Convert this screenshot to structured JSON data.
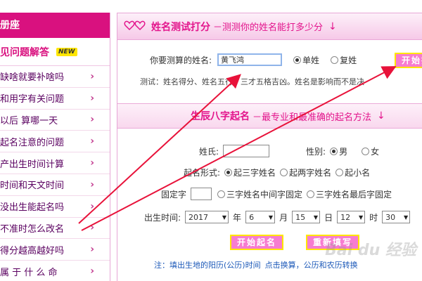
{
  "sidebar": {
    "header": "册座",
    "section_title": "见问题解答",
    "badge": "NEW",
    "items": [
      {
        "label": "缺啥就要补啥吗"
      },
      {
        "label": "和用字有关问题"
      },
      {
        "label": "以后  算哪一天"
      },
      {
        "label": "起名注意的问题"
      },
      {
        "label": "产出生时间计算"
      },
      {
        "label": "时间和天文时间"
      },
      {
        "label": "没出生能起名吗"
      },
      {
        "label": "不准时怎么改名"
      },
      {
        "label": "得分越高越好吗"
      },
      {
        "label": "属 于 什 么 命"
      }
    ],
    "chevron": "›"
  },
  "score_section": {
    "title": "姓名测试打分",
    "subtitle": "－测测你的姓名能打多少分",
    "arrow": "↓",
    "name_label": "你要测算的姓名:",
    "name_value": "黄飞鸿",
    "radio_single": "单姓",
    "radio_double": "复姓",
    "submit": "开始打",
    "desc": "测试：姓名得分、姓名五行、三才五格吉凶。姓名是影响而不是决"
  },
  "bazi_section": {
    "title": "生辰八字起名",
    "subtitle": "－最专业和最准确的起名方法",
    "arrow": "↓",
    "surname_label": "姓氏:",
    "surname_value": "",
    "gender_label": "性别:",
    "gender_male": "男",
    "gender_female": "女",
    "form_label": "起名形式:",
    "form_options": [
      "起三字姓名",
      "起两字姓名",
      "起小名"
    ],
    "fixed_label": "固定字",
    "fixed_value": "",
    "fixed_opt1": "三字姓名中间字固定",
    "fixed_opt2": "三字姓名最后字固定",
    "birth_label": "出生时间:",
    "year": "2017",
    "year_unit": "年",
    "month": "6",
    "month_unit": "月",
    "day": "15",
    "day_unit": "日",
    "hour": "12",
    "hour_unit": "时",
    "minute": "30",
    "start_button": "开始起名",
    "reset_button": "重新填写",
    "note_prefix": "注：填出生地的阳历(公历)时间",
    "note_link": "点击换算",
    "note_suffix": "，公历和农历转换"
  },
  "watermark": "Bai du 经验",
  "colors": {
    "accent": "#e3158c",
    "sidebar_header": "#d9117f",
    "button": "#f77cd0",
    "arrow": "#e8123a"
  }
}
